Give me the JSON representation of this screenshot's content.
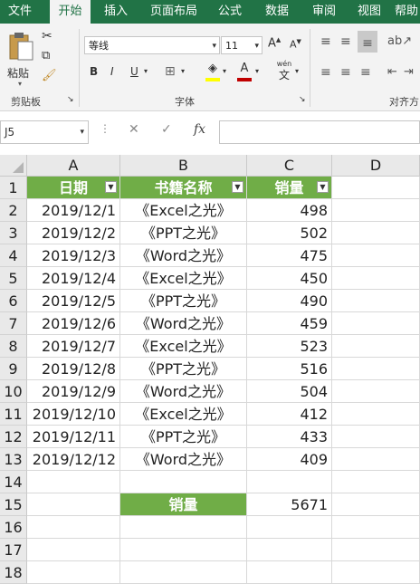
{
  "ribbon": {
    "tabs": [
      "文件",
      "开始",
      "插入",
      "页面布局",
      "公式",
      "数据",
      "审阅",
      "视图",
      "帮助"
    ],
    "active_tab": "开始",
    "clipboard": {
      "paste_label": "粘贴",
      "group_label": "剪贴板"
    },
    "font": {
      "name": "等线",
      "size": "11",
      "group_label": "字体",
      "bold": "B",
      "italic": "I",
      "underline": "U",
      "wen": "wén",
      "wen_char": "文"
    },
    "align": {
      "group_label": "对齐方"
    }
  },
  "formula_bar": {
    "name_box": "J5",
    "fx": "fx",
    "cancel": "✕",
    "enter": "✓"
  },
  "columns": [
    "A",
    "B",
    "C",
    "D"
  ],
  "row_numbers": [
    "1",
    "2",
    "3",
    "4",
    "5",
    "6",
    "7",
    "8",
    "9",
    "10",
    "11",
    "12",
    "13",
    "14",
    "15",
    "16",
    "17",
    "18"
  ],
  "table": {
    "headers": [
      "日期",
      "书籍名称",
      "销量"
    ],
    "rows": [
      [
        "2019/12/1",
        "《Excel之光》",
        "498"
      ],
      [
        "2019/12/2",
        "《PPT之光》",
        "502"
      ],
      [
        "2019/12/3",
        "《Word之光》",
        "475"
      ],
      [
        "2019/12/4",
        "《Excel之光》",
        "450"
      ],
      [
        "2019/12/5",
        "《PPT之光》",
        "490"
      ],
      [
        "2019/12/6",
        "《Word之光》",
        "459"
      ],
      [
        "2019/12/7",
        "《Excel之光》",
        "523"
      ],
      [
        "2019/12/8",
        "《PPT之光》",
        "516"
      ],
      [
        "2019/12/9",
        "《Word之光》",
        "504"
      ],
      [
        "2019/12/10",
        "《Excel之光》",
        "412"
      ],
      [
        "2019/12/11",
        "《PPT之光》",
        "433"
      ],
      [
        "2019/12/12",
        "《Word之光》",
        "409"
      ]
    ]
  },
  "summary": {
    "label": "销量",
    "value": "5671"
  },
  "colors": {
    "accent": "#217346",
    "header_fill": "#70ad47"
  }
}
